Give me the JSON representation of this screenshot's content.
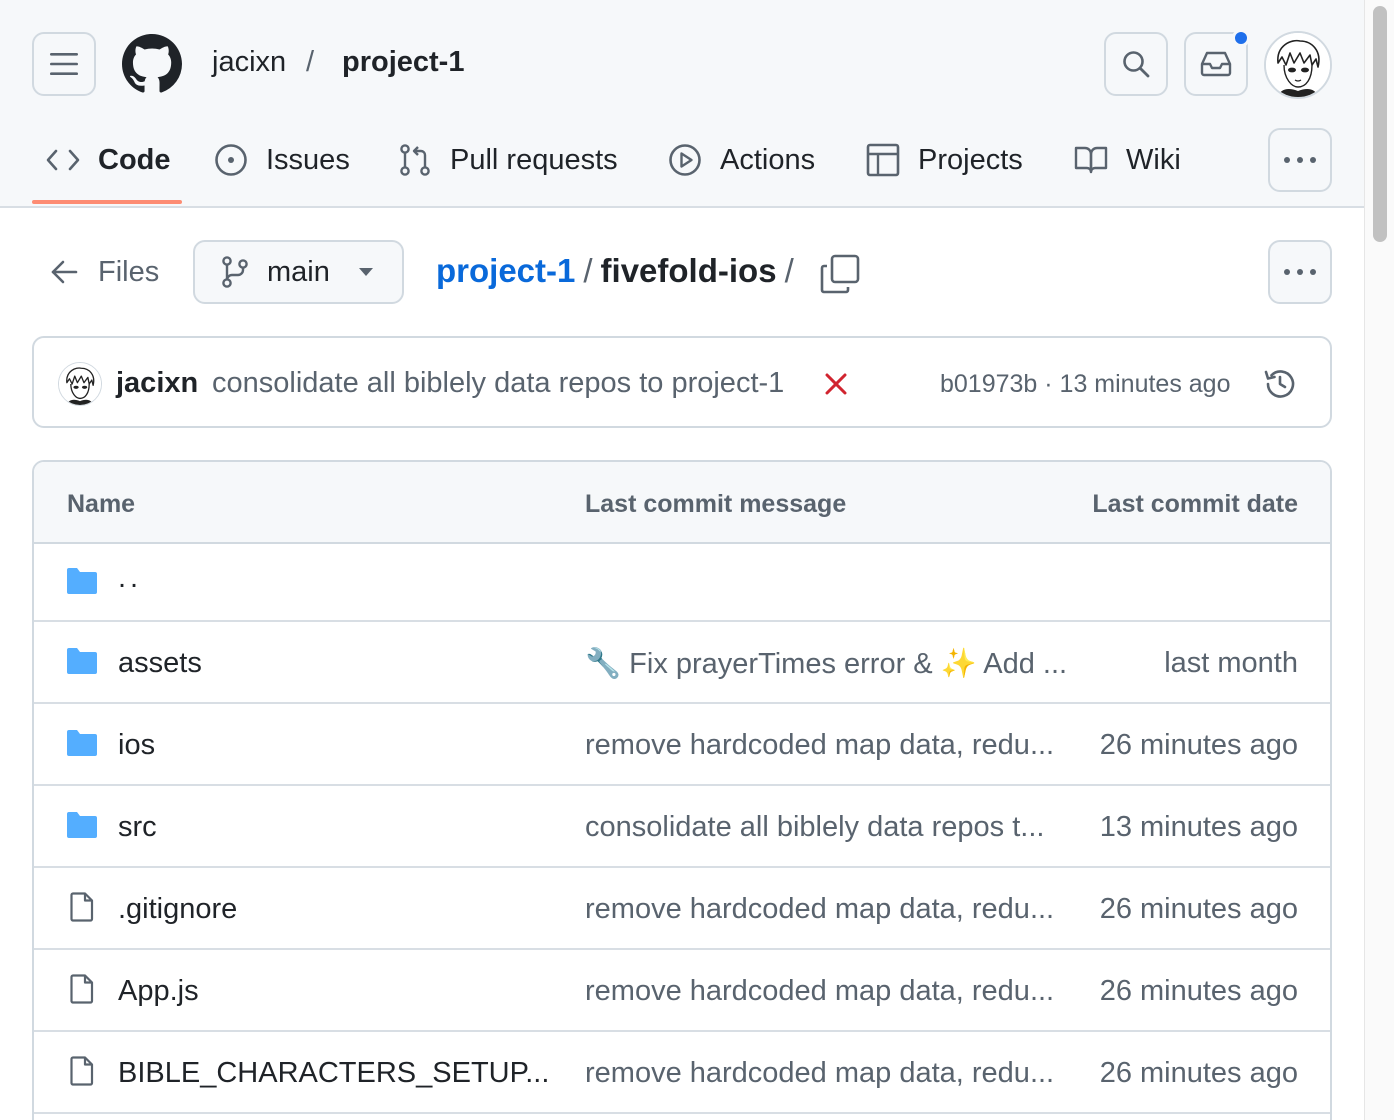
{
  "header": {
    "repo_owner": "jacixn",
    "repo_separator": "/",
    "repo_name": "project-1",
    "icons": [
      "hamburger-icon",
      "github-logo",
      "search-icon",
      "inbox-icon",
      "avatar"
    ]
  },
  "nav": {
    "tabs": [
      {
        "label": "Code",
        "icon": "code-icon",
        "active": true
      },
      {
        "label": "Issues",
        "icon": "issue-icon"
      },
      {
        "label": "Pull requests",
        "icon": "pull-request-icon"
      },
      {
        "label": "Actions",
        "icon": "play-icon"
      },
      {
        "label": "Projects",
        "icon": "table-icon"
      },
      {
        "label": "Wiki",
        "icon": "book-icon"
      }
    ],
    "active_color": "#fd8c73"
  },
  "path": {
    "back_label": "Files",
    "branch": "main",
    "root": "project-1",
    "separator": "/",
    "dir": "fivefold-ios"
  },
  "commit": {
    "author": "jacixn",
    "message": "consolidate all biblely data repos to project-1",
    "status": "failed",
    "meta": "b01973b · 13 minutes ago"
  },
  "table": {
    "headers": {
      "name": "Name",
      "message": "Last commit message",
      "date": "Last commit date"
    },
    "parent": "..",
    "rows": [
      {
        "type": "folder",
        "name": "assets",
        "message": "🔧 Fix prayerTimes error & ✨ Add ...",
        "date": "last month"
      },
      {
        "type": "folder",
        "name": "ios",
        "message": "remove hardcoded map data, redu...",
        "date": "26 minutes ago"
      },
      {
        "type": "folder",
        "name": "src",
        "message": "consolidate all biblely data repos t...",
        "date": "13 minutes ago"
      },
      {
        "type": "file",
        "name": ".gitignore",
        "message": "remove hardcoded map data, redu...",
        "date": "26 minutes ago"
      },
      {
        "type": "file",
        "name": "App.js",
        "message": "remove hardcoded map data, redu...",
        "date": "26 minutes ago"
      },
      {
        "type": "file",
        "name": "BIBLE_CHARACTERS_SETUP...",
        "message": "remove hardcoded map data, redu...",
        "date": "26 minutes ago"
      }
    ]
  },
  "colors": {
    "link": "#0969da",
    "muted": "#59636e",
    "folder": "#54aeff",
    "fail": "#d1242f",
    "notification": "#1f6feb"
  }
}
